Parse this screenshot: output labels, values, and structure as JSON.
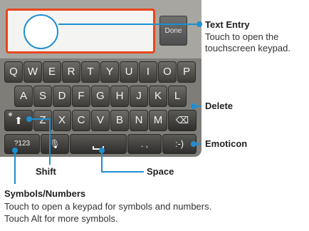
{
  "keyboard": {
    "done_label": "Done",
    "row1": [
      "Q",
      "W",
      "E",
      "R",
      "T",
      "Y",
      "U",
      "I",
      "O",
      "P"
    ],
    "row2": [
      "A",
      "S",
      "D",
      "F",
      "G",
      "H",
      "J",
      "K",
      "L"
    ],
    "row3": [
      "Z",
      "X",
      "C",
      "V",
      "B",
      "N",
      "M"
    ],
    "symbols_key": "?123",
    "punct_key": ". ,",
    "emoticon_key": ":-)",
    "shift_glyph": "⬆",
    "mic_glyph": "🎙",
    "delete_glyph": "⌫"
  },
  "callouts": {
    "text_entry": {
      "title": "Text Entry",
      "desc_line1": "Touch to open the",
      "desc_line2": "touchscreen keypad."
    },
    "delete": {
      "title": "Delete"
    },
    "emoticon": {
      "title": "Emoticon"
    },
    "shift": {
      "title": "Shift"
    },
    "space": {
      "title": "Space"
    },
    "symbols": {
      "title": "Symbols/Numbers",
      "desc_line1": "Touch to open a keypad for symbols and numbers.",
      "desc_line2": "Touch Alt for more symbols."
    }
  },
  "colors": {
    "callout_line": "#1e8fd0",
    "text_entry_border": "#e8461e"
  }
}
